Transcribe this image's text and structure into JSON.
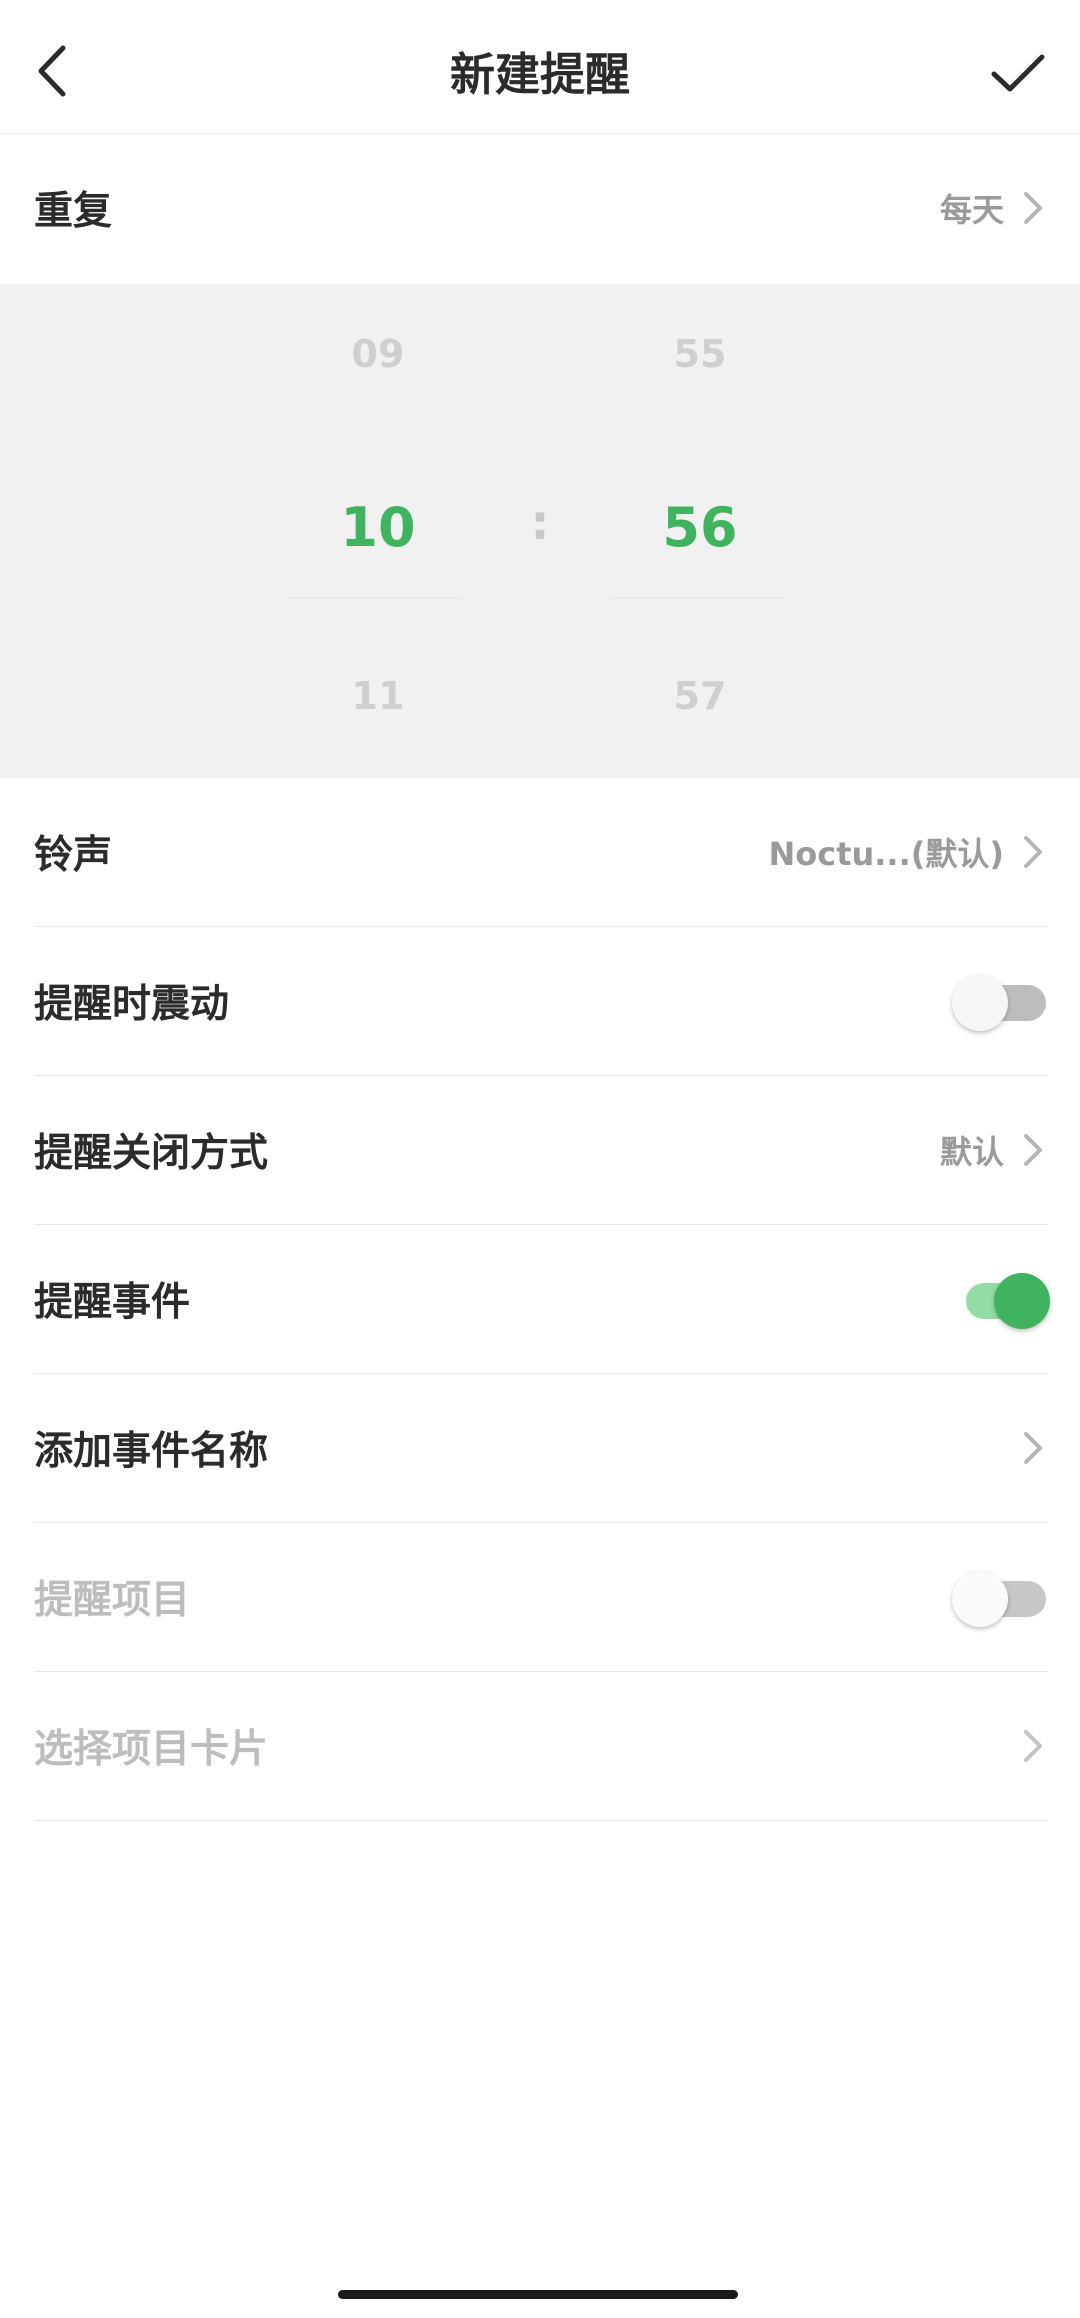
{
  "header": {
    "title": "新建提醒",
    "back_icon": "chevron-left-icon",
    "confirm_icon": "checkmark-icon"
  },
  "repeat": {
    "label": "重复",
    "value": "每天"
  },
  "time_picker": {
    "hour_prev": "09",
    "hour_selected": "10",
    "hour_next": "11",
    "minute_prev": "55",
    "minute_selected": "56",
    "minute_next": "57",
    "separator": ":",
    "accent_color": "#3fb35e"
  },
  "settings": {
    "ringtone": {
      "label": "铃声",
      "value": "Noctu...(默认)"
    },
    "vibrate": {
      "label": "提醒时震动",
      "enabled": false
    },
    "close_mode": {
      "label": "提醒关闭方式",
      "value": "默认"
    },
    "event": {
      "label": "提醒事件",
      "enabled": true
    },
    "event_name": {
      "label": "添加事件名称"
    },
    "project": {
      "label": "提醒项目",
      "enabled": false,
      "disabled": true
    },
    "project_card": {
      "label": "选择项目卡片",
      "disabled": true
    }
  }
}
